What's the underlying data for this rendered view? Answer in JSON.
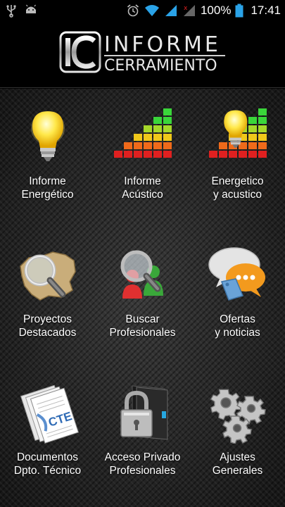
{
  "status_bar": {
    "battery_percent": "100%",
    "time": "17:41",
    "icons": [
      "usb-icon",
      "android-icon",
      "alarm-icon",
      "wifi-icon",
      "signal-icon",
      "signal-roaming-icon",
      "battery-icon"
    ]
  },
  "header": {
    "logo_mark": "IC",
    "logo_line1": "INFORME",
    "logo_line2": "CERRAMIENTO"
  },
  "tiles": [
    {
      "label": "Informe\nEnergético",
      "icon": "lightbulb-icon"
    },
    {
      "label": "Informe\nAcústico",
      "icon": "sound-meter-icon"
    },
    {
      "label": "Energetico\ny acustico",
      "icon": "lightbulb-meter-icon"
    },
    {
      "label": "Proyectos\nDestacados",
      "icon": "magnifier-map-icon"
    },
    {
      "label": "Buscar\nProfesionales",
      "icon": "people-search-icon"
    },
    {
      "label": "Ofertas\ny noticias",
      "icon": "speech-bubbles-icon"
    },
    {
      "label": "Documentos\nDpto. Técnico",
      "icon": "cte-documents-icon",
      "doc_tag": "CTE"
    },
    {
      "label": "Acceso Privado\nProfesionales",
      "icon": "padlock-folder-icon"
    },
    {
      "label": "Ajustes\nGenerales",
      "icon": "gears-icon"
    }
  ],
  "colors": {
    "background": "#1c1c1c",
    "text": "#ffffff",
    "bulb_yellow": "#ffe84a",
    "meter_green": "#3ad63a",
    "meter_red": "#e02020",
    "bubble_orange": "#f39a1e",
    "bubble_blue": "#6aa3d8"
  }
}
